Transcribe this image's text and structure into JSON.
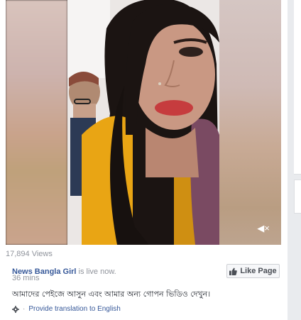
{
  "video": {
    "mute_icon": "mute-icon",
    "mute_glyph": "◀×"
  },
  "stats": {
    "views": "17,894 Views"
  },
  "post": {
    "page_name": "News Bangla Girl",
    "status": " is live now.",
    "time": "36 mins",
    "like_page_label": "Like Page",
    "caption": "আমাদের পেইজে আসুন এবং আমার অন্য গোপন ভিডিও দেখুন।",
    "translation_link": "Provide translation to English"
  },
  "colors": {
    "link": "#365899",
    "muted": "#90949c",
    "background": "#e9ebee"
  }
}
